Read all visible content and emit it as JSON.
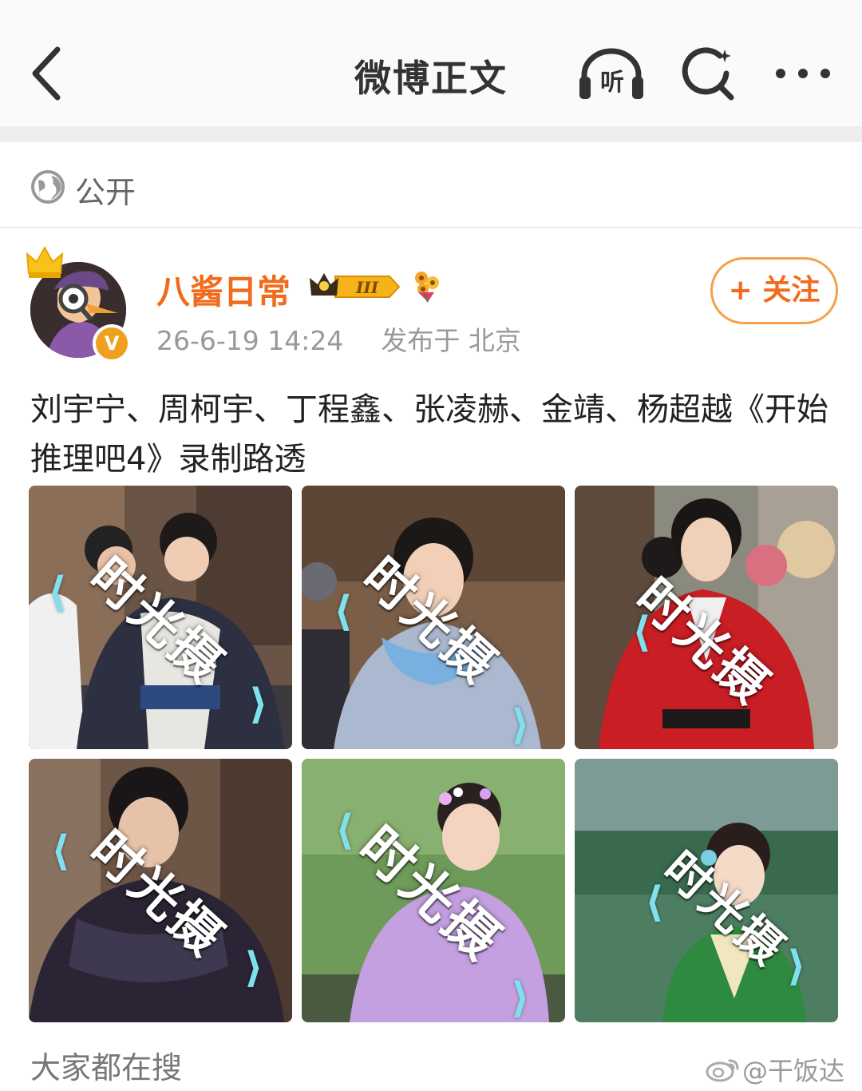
{
  "navbar": {
    "title": "微博正文",
    "listen_label": "听"
  },
  "visibility": {
    "label": "公开"
  },
  "author": {
    "name": "八酱日常",
    "level_badge": "III",
    "timestamp": "26-6-19 14:24",
    "location": "发布于 北京",
    "verified_mark": "V",
    "follow_label": "+ 关注"
  },
  "post": {
    "text": "刘宇宁、周柯宇、丁程鑫、张凌赫、金靖、杨超越《开始推理吧4》录制路透"
  },
  "images": [
    {
      "watermark": "时光摄"
    },
    {
      "watermark": "时光摄"
    },
    {
      "watermark": "时光摄"
    },
    {
      "watermark": "时光摄"
    },
    {
      "watermark": "时光摄"
    },
    {
      "watermark": "时光摄"
    }
  ],
  "footer": {
    "section_label": "大家都在搜",
    "weibo_watermark": "@干饭达子"
  },
  "colors": {
    "accent": "#f26b1d",
    "follow_border": "#f5a04a",
    "meta_text": "#999999"
  },
  "icons": [
    "back-arrow-icon",
    "headphones-icon",
    "search-icon",
    "more-icon",
    "globe-icon",
    "crown-icon",
    "verified-icon",
    "level-badge-icon",
    "flower-icon",
    "weibo-logo-icon"
  ]
}
